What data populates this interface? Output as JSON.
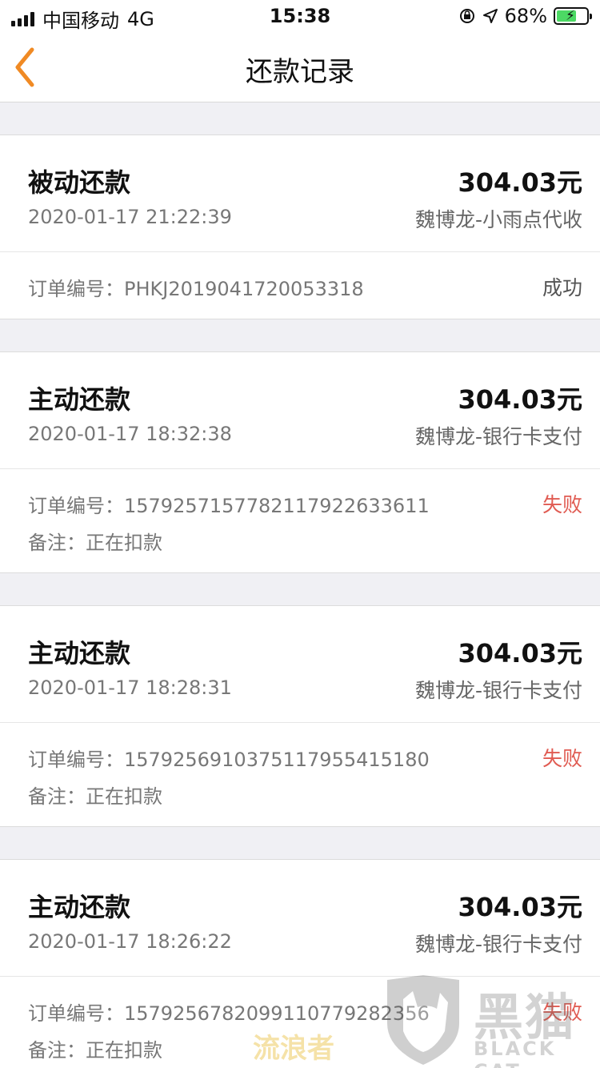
{
  "status_bar": {
    "carrier": "中国移动",
    "network": "4G",
    "time": "15:38",
    "battery": "68%",
    "battery_level": 0.68
  },
  "nav": {
    "title": "还款记录",
    "back_icon": "chevron-left-icon",
    "accent_color": "#f08a24"
  },
  "records": [
    {
      "type": "被动还款",
      "amount": "304.03元",
      "time": "2020-01-17 21:22:39",
      "channel": "魏博龙-小雨点代收",
      "order": "订单编号：PHKJ2019041720053318",
      "status": "成功",
      "note": ""
    },
    {
      "type": "主动还款",
      "amount": "304.03元",
      "time": "2020-01-17 18:32:38",
      "channel": "魏博龙-银行卡支付",
      "order": "订单编号：157925715778211792263361​1",
      "status": "失败",
      "note": "备注：正在扣款"
    },
    {
      "type": "主动还款",
      "amount": "304.03元",
      "time": "2020-01-17 18:28:31",
      "channel": "魏博龙-银行卡支付",
      "order": "订单编号：157925691037511795541518​0",
      "status": "失败",
      "note": "备注：正在扣款"
    },
    {
      "type": "主动还款",
      "amount": "304.03元",
      "time": "2020-01-17 18:26:22",
      "channel": "魏博龙-银行卡支付",
      "order": "订单编号：157925678209911077928235​6",
      "status": "失败",
      "note": "备注：正在扣款"
    }
  ],
  "watermark": {
    "title": "黑猫",
    "subtitle": "BLACK CAT",
    "secondary": "流浪者"
  }
}
